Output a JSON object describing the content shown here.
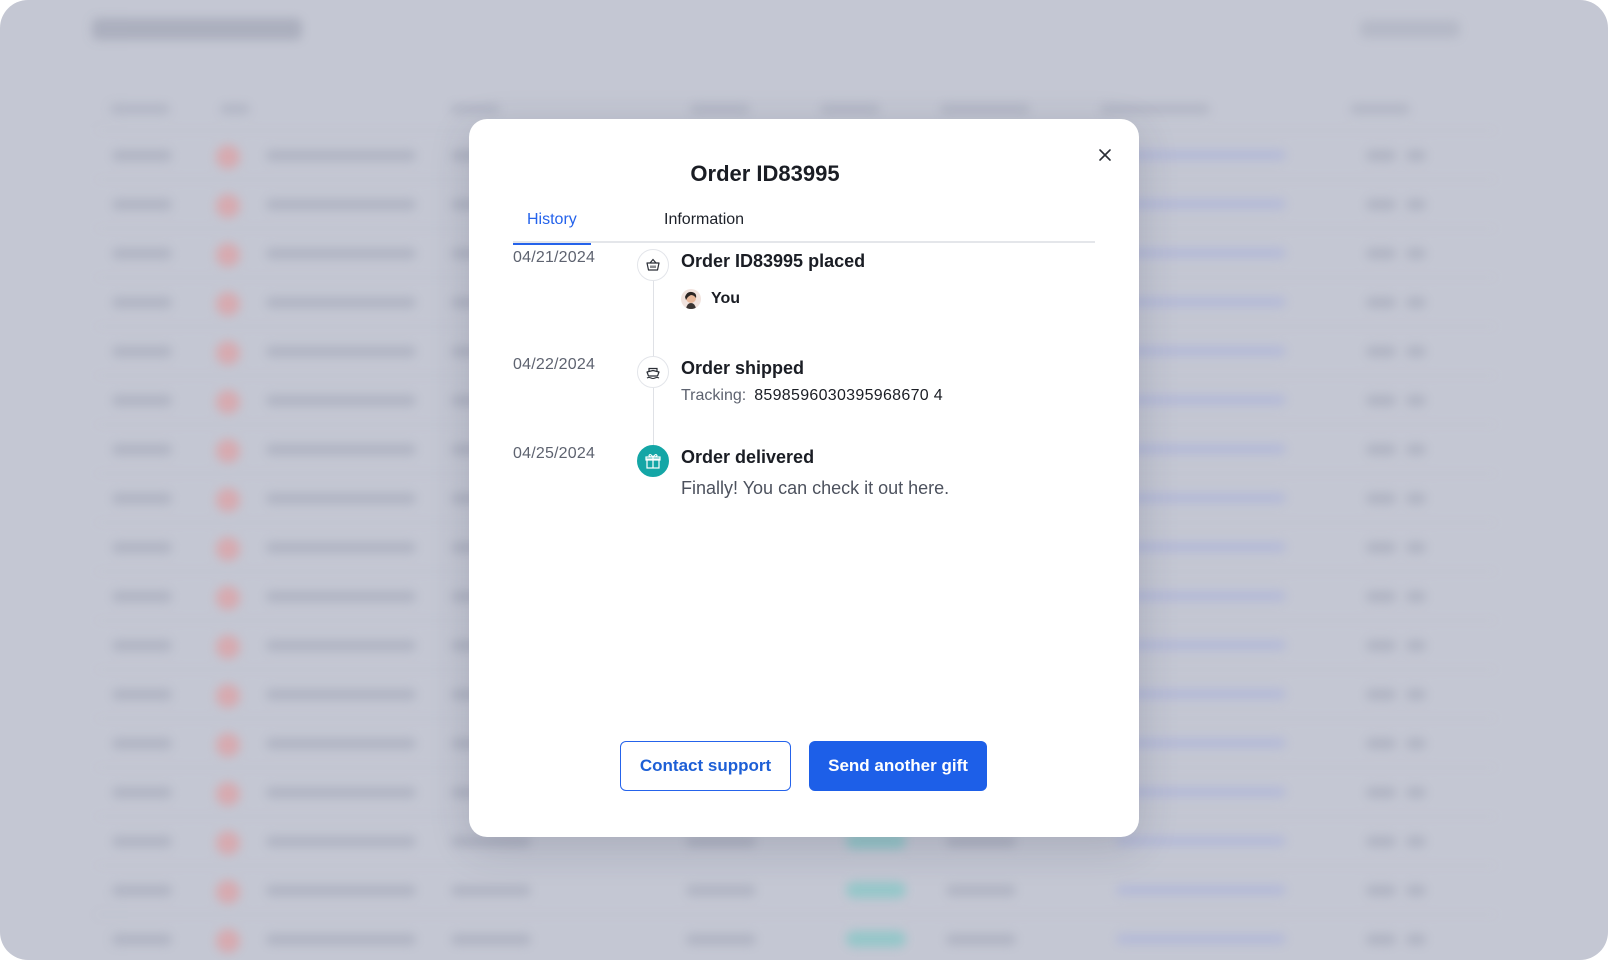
{
  "modal": {
    "title": "Order ID83995",
    "close_icon": "close-icon",
    "tabs": [
      {
        "label": "History",
        "active": true
      },
      {
        "label": "Information",
        "active": false
      }
    ],
    "timeline": [
      {
        "date": "04/21/2024",
        "icon": "basket-icon",
        "title": "Order ID83995 placed",
        "user": "You"
      },
      {
        "date": "04/22/2024",
        "icon": "ship-icon",
        "title": "Order shipped",
        "tracking_label": "Tracking:",
        "tracking_value": "8598596030395968670 4"
      },
      {
        "date": "04/25/2024",
        "icon": "gift-icon",
        "title": "Order delivered",
        "description": "Finally! You can check it out here."
      }
    ],
    "buttons": {
      "contact_support": "Contact support",
      "send_gift": "Send another gift"
    }
  },
  "colors": {
    "accent": "#2563eb",
    "delivered_icon": "#14a6a6",
    "backdrop": "#c4c7d3"
  }
}
